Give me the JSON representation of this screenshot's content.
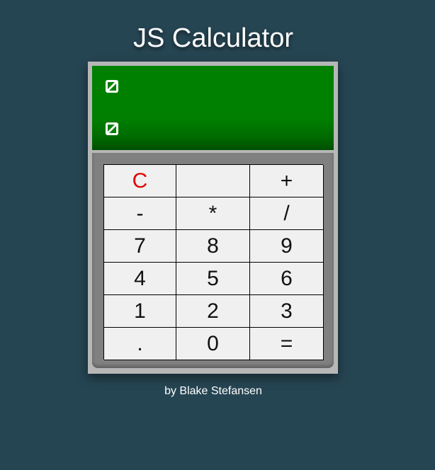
{
  "page": {
    "title": "JS Calculator",
    "credit": "by Blake Stefansen"
  },
  "display": {
    "line1_icon": "broken-image-icon",
    "line1_value": "",
    "line2_icon": "broken-image-icon",
    "line2_value": ""
  },
  "keypad": {
    "rows": [
      [
        {
          "label": "C",
          "name": "clear-button"
        },
        {
          "label": "",
          "name": "blank-button"
        },
        {
          "label": "+",
          "name": "plus-button"
        }
      ],
      [
        {
          "label": "-",
          "name": "minus-button"
        },
        {
          "label": "*",
          "name": "multiply-button"
        },
        {
          "label": "/",
          "name": "divide-button"
        }
      ],
      [
        {
          "label": "7",
          "name": "digit-7-button"
        },
        {
          "label": "8",
          "name": "digit-8-button"
        },
        {
          "label": "9",
          "name": "digit-9-button"
        }
      ],
      [
        {
          "label": "4",
          "name": "digit-4-button"
        },
        {
          "label": "5",
          "name": "digit-5-button"
        },
        {
          "label": "6",
          "name": "digit-6-button"
        }
      ],
      [
        {
          "label": "1",
          "name": "digit-1-button"
        },
        {
          "label": "2",
          "name": "digit-2-button"
        },
        {
          "label": "3",
          "name": "digit-3-button"
        }
      ],
      [
        {
          "label": ".",
          "name": "decimal-button"
        },
        {
          "label": "0",
          "name": "digit-0-button"
        },
        {
          "label": "=",
          "name": "equals-button"
        }
      ]
    ]
  },
  "colors": {
    "background": "#264553",
    "display_green": "#008000",
    "clear_red": "#e00000",
    "key_face": "#f0f0f0"
  }
}
